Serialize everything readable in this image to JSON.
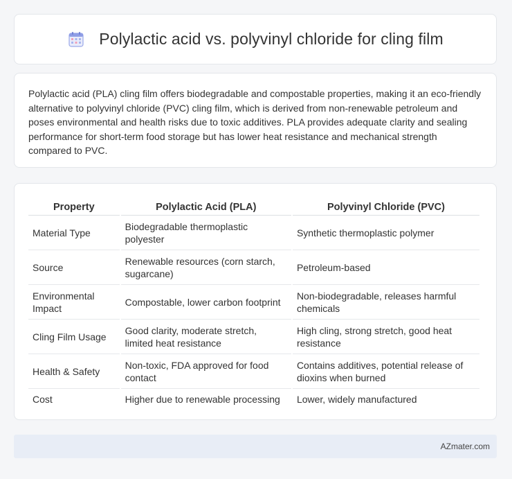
{
  "header": {
    "title": "Polylactic acid vs. polyvinyl chloride for cling film",
    "icon": "calendar-icon"
  },
  "intro": {
    "text": "Polylactic acid (PLA) cling film offers biodegradable and compostable properties, making it an eco-friendly alternative to polyvinyl chloride (PVC) cling film, which is derived from non-renewable petroleum and poses environmental and health risks due to toxic additives. PLA provides adequate clarity and sealing performance for short-term food storage but has lower heat resistance and mechanical strength compared to PVC."
  },
  "table": {
    "headers": [
      "Property",
      "Polylactic Acid (PLA)",
      "Polyvinyl Chloride (PVC)"
    ],
    "rows": [
      [
        "Material Type",
        "Biodegradable thermoplastic polyester",
        "Synthetic thermoplastic polymer"
      ],
      [
        "Source",
        "Renewable resources (corn starch, sugarcane)",
        "Petroleum-based"
      ],
      [
        "Environmental Impact",
        "Compostable, lower carbon footprint",
        "Non-biodegradable, releases harmful chemicals"
      ],
      [
        "Cling Film Usage",
        "Good clarity, moderate stretch, limited heat resistance",
        "High cling, strong stretch, good heat resistance"
      ],
      [
        "Health & Safety",
        "Non-toxic, FDA approved for food contact",
        "Contains additives, potential release of dioxins when burned"
      ],
      [
        "Cost",
        "Higher due to renewable processing",
        "Lower, widely manufactured"
      ]
    ]
  },
  "footer": {
    "brand": "AZmater.com"
  },
  "colors": {
    "background": "#f5f6f8",
    "card": "#ffffff",
    "footer": "#e8edf6",
    "icon_accent": "#7b8fe0"
  }
}
